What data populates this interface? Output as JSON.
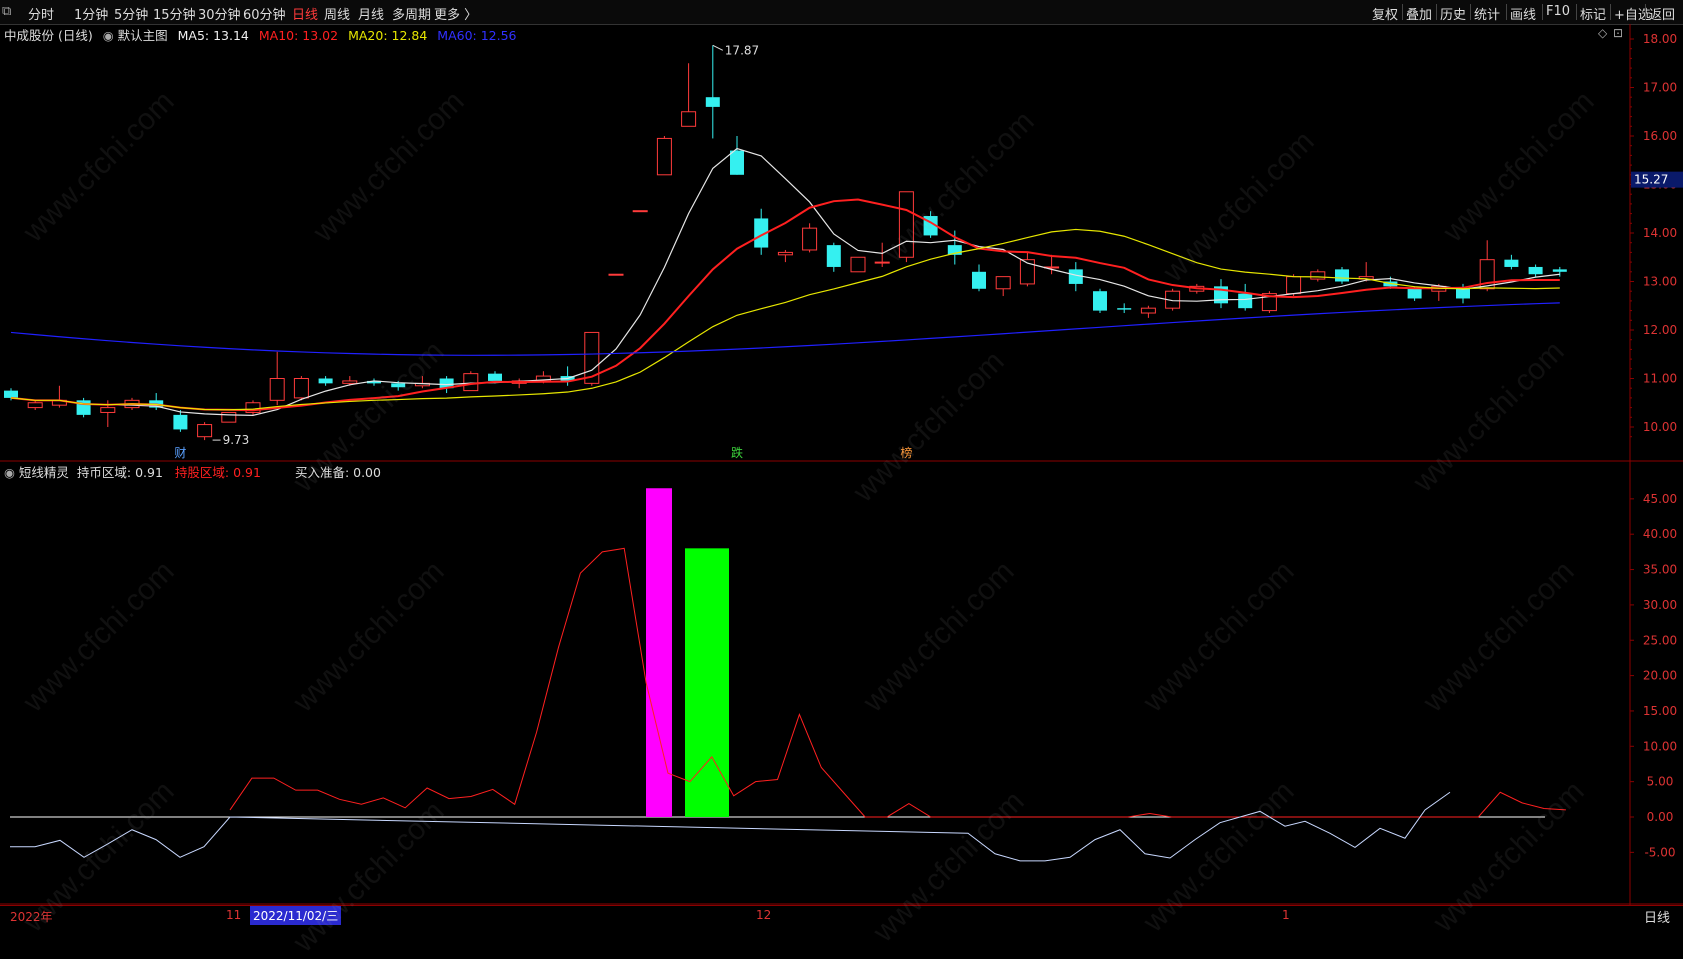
{
  "toolbar": {
    "left": [
      "分时",
      "1分钟",
      "5分钟",
      "15分钟",
      "30分钟",
      "60分钟",
      "日线",
      "周线",
      "月线",
      "多周期",
      "更多 〉"
    ],
    "active_index": 6,
    "right": [
      "复权",
      "叠加",
      "历史",
      "统计",
      "画线",
      "F10",
      "标记",
      "+自选",
      "返回"
    ]
  },
  "main_legend": {
    "stock": "中成股份 (日线)",
    "template": "默认主图",
    "ma5": "MA5: 13.14",
    "ma10": "MA10: 13.02",
    "ma20": "MA20: 12.84",
    "ma60": "MA60: 12.56"
  },
  "colors": {
    "up": "#ff3b3b",
    "down": "#35f0f0",
    "ma5": "#e6e6e6",
    "ma10": "#ff2020",
    "ma20": "#e6e600",
    "ma60": "#2020ff",
    "pink": "#ff00ff",
    "green": "#00ff00"
  },
  "sub_legend": {
    "name": "短线精灵",
    "hold_coin": "持币区域: 0.91",
    "hold_stock": "持股区域: 0.91",
    "buy_ready": "买入准备: 0.00"
  },
  "price_axis": [
    "18.00",
    "17.00",
    "16.00",
    "15.00",
    "14.00",
    "13.00",
    "12.00",
    "11.00",
    "10.00"
  ],
  "current_price": "15.27",
  "max_label": "17.87",
  "min_label": "9.73",
  "markers": [
    "财",
    "跌",
    "榜"
  ],
  "sub_axis": [
    "45.00",
    "40.00",
    "35.00",
    "30.00",
    "25.00",
    "20.00",
    "15.00",
    "10.00",
    "5.00",
    "0.00",
    "-5.00"
  ],
  "dates": [
    "2022年",
    "11",
    "2022/11/02/三",
    "12",
    "1"
  ],
  "period_button": "日线",
  "watermark": "www.cfchi.com",
  "chart_data": {
    "type": "candlestick",
    "candles": [
      {
        "o": 10.75,
        "h": 10.8,
        "l": 10.55,
        "c": 10.6
      },
      {
        "o": 10.4,
        "h": 10.55,
        "l": 10.35,
        "c": 10.5
      },
      {
        "o": 10.45,
        "h": 10.85,
        "l": 10.4,
        "c": 10.55
      },
      {
        "o": 10.55,
        "h": 10.6,
        "l": 10.2,
        "c": 10.25
      },
      {
        "o": 10.3,
        "h": 10.55,
        "l": 10.0,
        "c": 10.4
      },
      {
        "o": 10.4,
        "h": 10.6,
        "l": 10.35,
        "c": 10.55
      },
      {
        "o": 10.55,
        "h": 10.7,
        "l": 10.35,
        "c": 10.4
      },
      {
        "o": 10.25,
        "h": 10.35,
        "l": 9.9,
        "c": 9.95
      },
      {
        "o": 9.8,
        "h": 10.1,
        "l": 9.73,
        "c": 10.05
      },
      {
        "o": 10.1,
        "h": 10.3,
        "l": 10.1,
        "c": 10.3
      },
      {
        "o": 10.3,
        "h": 10.55,
        "l": 10.25,
        "c": 10.5
      },
      {
        "o": 10.55,
        "h": 11.55,
        "l": 10.45,
        "c": 11.0
      },
      {
        "o": 10.6,
        "h": 11.05,
        "l": 10.55,
        "c": 11.0
      },
      {
        "o": 11.0,
        "h": 11.05,
        "l": 10.85,
        "c": 10.9
      },
      {
        "o": 10.9,
        "h": 11.05,
        "l": 10.85,
        "c": 10.95
      },
      {
        "o": 10.95,
        "h": 11.0,
        "l": 10.85,
        "c": 10.9
      },
      {
        "o": 10.9,
        "h": 10.95,
        "l": 10.75,
        "c": 10.82
      },
      {
        "o": 10.85,
        "h": 11.05,
        "l": 10.8,
        "c": 10.9
      },
      {
        "o": 11.0,
        "h": 11.05,
        "l": 10.7,
        "c": 10.8
      },
      {
        "o": 10.75,
        "h": 11.15,
        "l": 10.75,
        "c": 11.1
      },
      {
        "o": 11.1,
        "h": 11.15,
        "l": 10.9,
        "c": 10.95
      },
      {
        "o": 10.9,
        "h": 11.0,
        "l": 10.8,
        "c": 10.95
      },
      {
        "o": 10.95,
        "h": 11.15,
        "l": 10.9,
        "c": 11.05
      },
      {
        "o": 11.05,
        "h": 11.25,
        "l": 10.85,
        "c": 10.95
      },
      {
        "o": 10.9,
        "h": 11.95,
        "l": 10.85,
        "c": 11.95
      },
      {
        "o": 13.15,
        "h": 13.15,
        "l": 13.15,
        "c": 13.15
      },
      {
        "o": 14.46,
        "h": 14.46,
        "l": 14.46,
        "c": 14.46
      },
      {
        "o": 15.2,
        "h": 16.0,
        "l": 15.2,
        "c": 15.95
      },
      {
        "o": 16.2,
        "h": 17.5,
        "l": 16.2,
        "c": 16.5
      },
      {
        "o": 16.8,
        "h": 17.87,
        "l": 15.95,
        "c": 16.6
      },
      {
        "o": 15.7,
        "h": 16.0,
        "l": 15.2,
        "c": 15.2
      },
      {
        "o": 14.3,
        "h": 14.5,
        "l": 13.55,
        "c": 13.7
      },
      {
        "o": 13.55,
        "h": 13.65,
        "l": 13.4,
        "c": 13.6
      },
      {
        "o": 13.65,
        "h": 14.2,
        "l": 13.6,
        "c": 14.1
      },
      {
        "o": 13.75,
        "h": 13.8,
        "l": 13.2,
        "c": 13.3
      },
      {
        "o": 13.2,
        "h": 13.5,
        "l": 13.2,
        "c": 13.5
      },
      {
        "o": 13.4,
        "h": 13.8,
        "l": 13.3,
        "c": 13.4
      },
      {
        "o": 13.5,
        "h": 14.85,
        "l": 13.4,
        "c": 14.85
      },
      {
        "o": 14.35,
        "h": 14.45,
        "l": 13.9,
        "c": 13.95
      },
      {
        "o": 13.75,
        "h": 14.05,
        "l": 13.35,
        "c": 13.55
      },
      {
        "o": 13.2,
        "h": 13.35,
        "l": 12.8,
        "c": 12.85
      },
      {
        "o": 12.85,
        "h": 13.1,
        "l": 12.7,
        "c": 13.1
      },
      {
        "o": 12.95,
        "h": 13.6,
        "l": 12.9,
        "c": 13.45
      },
      {
        "o": 13.3,
        "h": 13.55,
        "l": 13.15,
        "c": 13.3
      },
      {
        "o": 13.25,
        "h": 13.4,
        "l": 12.8,
        "c": 12.95
      },
      {
        "o": 12.8,
        "h": 12.85,
        "l": 12.35,
        "c": 12.4
      },
      {
        "o": 12.45,
        "h": 12.55,
        "l": 12.35,
        "c": 12.42
      },
      {
        "o": 12.35,
        "h": 12.5,
        "l": 12.25,
        "c": 12.45
      },
      {
        "o": 12.45,
        "h": 12.85,
        "l": 12.4,
        "c": 12.8
      },
      {
        "o": 12.8,
        "h": 12.95,
        "l": 12.75,
        "c": 12.9
      },
      {
        "o": 12.9,
        "h": 13.05,
        "l": 12.45,
        "c": 12.55
      },
      {
        "o": 12.75,
        "h": 12.95,
        "l": 12.4,
        "c": 12.45
      },
      {
        "o": 12.4,
        "h": 12.8,
        "l": 12.35,
        "c": 12.75
      },
      {
        "o": 12.75,
        "h": 13.15,
        "l": 12.7,
        "c": 13.1
      },
      {
        "o": 13.05,
        "h": 13.25,
        "l": 13.0,
        "c": 13.2
      },
      {
        "o": 13.25,
        "h": 13.3,
        "l": 12.95,
        "c": 13.0
      },
      {
        "o": 13.05,
        "h": 13.4,
        "l": 13.0,
        "c": 13.1
      },
      {
        "o": 13.0,
        "h": 13.1,
        "l": 12.85,
        "c": 12.9
      },
      {
        "o": 12.85,
        "h": 12.9,
        "l": 12.6,
        "c": 12.65
      },
      {
        "o": 12.8,
        "h": 12.95,
        "l": 12.6,
        "c": 12.9
      },
      {
        "o": 12.85,
        "h": 12.95,
        "l": 12.55,
        "c": 12.65
      },
      {
        "o": 12.85,
        "h": 13.85,
        "l": 12.8,
        "c": 13.45
      },
      {
        "o": 13.45,
        "h": 13.55,
        "l": 13.25,
        "c": 13.3
      },
      {
        "o": 13.3,
        "h": 13.35,
        "l": 13.1,
        "c": 13.15
      },
      {
        "o": 13.25,
        "h": 13.3,
        "l": 13.1,
        "c": 13.2
      }
    ],
    "ma60_start": 11.95,
    "ma60_end": 12.56,
    "sub_red": [
      1.0,
      5.5,
      5.5,
      3.8,
      3.8,
      2.5,
      1.8,
      2.7,
      1.3,
      4.1,
      2.6,
      2.9,
      3.9,
      1.8,
      12.0,
      24.0,
      34.5,
      37.5,
      38.0,
      19.0,
      6.2,
      5.0,
      8.5,
      3.0,
      5.0,
      5.3,
      14.5,
      7.0,
      3.5,
      0.0,
      0.0,
      1.9,
      0.0,
      0.0,
      0.0,
      0.0,
      0.0,
      0.0,
      0.0,
      0.0,
      0.0,
      0.0,
      0.5,
      0.0,
      0.0,
      0.0,
      0.0,
      0.0,
      0.0,
      0.0,
      0.0,
      0.0,
      0.0,
      0.0,
      0.0,
      0.0,
      0.0,
      0.0,
      3.5,
      2.0,
      1.2,
      1.0
    ],
    "sub_white": [
      -4.2,
      -4.2,
      -3.3,
      -5.7,
      -3.8,
      -1.8,
      -3.2,
      -5.7,
      -4.2,
      0.0,
      -2.3,
      -5.2,
      -6.2,
      -6.2,
      -5.7,
      -3.2,
      -1.8,
      -5.2,
      -5.8,
      -3.2,
      -0.8,
      0.8,
      -1.3,
      -0.6,
      -2.3,
      -4.3,
      -1.6,
      -3.0,
      1.0,
      3.5
    ],
    "bars": [
      {
        "value": 46.5,
        "color": "#ff00ff"
      },
      {
        "value": 38.0,
        "color": "#00ff00"
      }
    ]
  }
}
